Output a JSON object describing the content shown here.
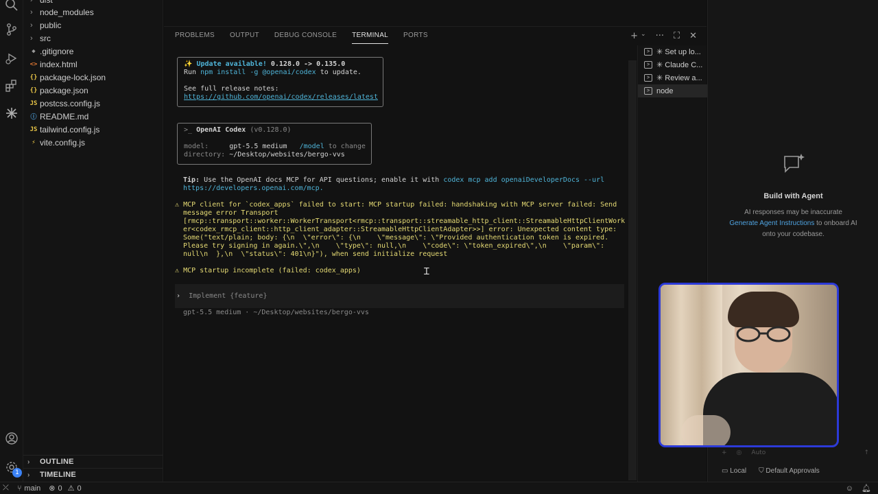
{
  "explorer": {
    "items": [
      {
        "type": "folder",
        "label": "dist"
      },
      {
        "type": "folder",
        "label": "node_modules"
      },
      {
        "type": "folder",
        "label": "public"
      },
      {
        "type": "folder",
        "label": "src"
      },
      {
        "type": "file",
        "icon": "◆",
        "iconColor": "#9a9a9a",
        "label": ".gitignore"
      },
      {
        "type": "file",
        "icon": "<>",
        "iconColor": "#e37933",
        "label": "index.html"
      },
      {
        "type": "file",
        "icon": "{}",
        "iconColor": "#e8c547",
        "label": "package-lock.json"
      },
      {
        "type": "file",
        "icon": "{}",
        "iconColor": "#e8c547",
        "label": "package.json"
      },
      {
        "type": "file",
        "icon": "JS",
        "iconColor": "#e8c547",
        "label": "postcss.config.js"
      },
      {
        "type": "file",
        "icon": "ⓘ",
        "iconColor": "#4fa3e0",
        "label": "README.md"
      },
      {
        "type": "file",
        "icon": "JS",
        "iconColor": "#e8c547",
        "label": "tailwind.config.js"
      },
      {
        "type": "file",
        "icon": "⚡",
        "iconColor": "#e8c547",
        "label": "vite.config.js"
      }
    ],
    "outline": "OUTLINE",
    "timeline": "TIMELINE"
  },
  "panel": {
    "tabs": [
      "PROBLEMS",
      "OUTPUT",
      "DEBUG CONSOLE",
      "TERMINAL",
      "PORTS"
    ]
  },
  "terminal": {
    "update": {
      "title": "Update available!",
      "versions": "0.128.0 -> 0.135.0",
      "run_pre": "Run ",
      "run_cmd": "npm install -g @openai/codex",
      "run_post": " to update.",
      "notes": "See full release notes:",
      "url": "https://github.com/openai/codex/releases/latest"
    },
    "header": {
      "prompt": ">_",
      "name": "OpenAI Codex",
      "version": "(v0.128.0)",
      "model_label": "model:",
      "model_value": "gpt-5.5 medium",
      "model_cmd": "/model",
      "model_hint": "to change",
      "dir_label": "directory:",
      "dir_value": "~/Desktop/websites/bergo-vvs"
    },
    "tip": {
      "label": "Tip:",
      "text": "Use the OpenAI docs MCP for API questions; enable it with",
      "cmd": "codex mcp add openaiDeveloperDocs --url",
      "url": "https://developers.openai.com/mcp."
    },
    "error_lines": [
      "MCP client for `codex_apps` failed to start: MCP startup failed: handshaking with MCP server failed: Send",
      "message error Transport",
      "[rmcp::transport::worker::WorkerTransport<rmcp::transport::streamable_http_client::StreamableHttpClientWork",
      "er<codex_rmcp_client::http_client_adapter::StreamableHttpClientAdapter>>] error: Unexpected content type:",
      "Some(\"text/plain; body: {\\n  \\\"error\\\": {\\n    \\\"message\\\": \\\"Provided authentication token is expired.",
      "Please try signing in again.\\\",\\n    \\\"type\\\": null,\\n    \\\"code\\\": \\\"token_expired\\\",\\n    \\\"param\\\":",
      "null\\n  },\\n  \\\"status\\\": 401\\n}\"), when send initialize request"
    ],
    "warn_symbol": "⚠",
    "incomplete": "MCP startup incomplete (failed: codex_apps)",
    "prompt_symbol": "›",
    "placeholder": "Implement {feature}",
    "footer": "gpt-5.5 medium · ~/Desktop/websites/bergo-vvs"
  },
  "terminal_list": [
    {
      "label": "✳ Set up lo...",
      "selected": false
    },
    {
      "label": "✳ Claude C...",
      "selected": false
    },
    {
      "label": "✳ Review a...",
      "selected": false
    },
    {
      "label": "node",
      "selected": true
    }
  ],
  "agent": {
    "title": "Build with Agent",
    "line1": "AI responses may be inaccurate",
    "link": "Generate Agent Instructions",
    "line2": " to onboard AI",
    "line3": "onto your codebase.",
    "input_auto": "Auto",
    "local": "Local",
    "approvals": "Default Approvals"
  },
  "status": {
    "branch": "main",
    "errors": "0",
    "warnings": "0"
  }
}
